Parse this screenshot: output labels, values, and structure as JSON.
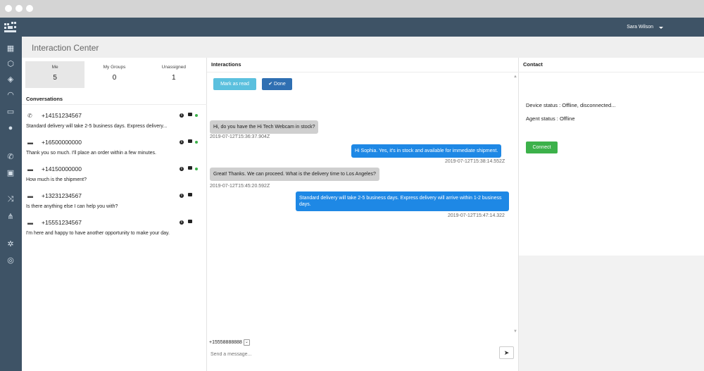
{
  "header": {
    "user_name": "Sara Wilson"
  },
  "nav": {
    "items": [
      {
        "icon": "dashboard-icon",
        "glyph": "▦"
      },
      {
        "icon": "cube-icon",
        "glyph": "⬡"
      },
      {
        "icon": "tag-icon",
        "glyph": "◈"
      },
      {
        "icon": "headset-icon",
        "glyph": "◠"
      },
      {
        "icon": "chat-icon",
        "glyph": "▭"
      },
      {
        "icon": "users-icon",
        "glyph": "●"
      },
      {
        "icon": "phone-icon",
        "glyph": "✆"
      },
      {
        "icon": "comment-alert-icon",
        "glyph": "▣"
      },
      {
        "icon": "shuffle-icon",
        "glyph": "⤨"
      },
      {
        "icon": "sitemap-icon",
        "glyph": "⋔"
      },
      {
        "icon": "gear-icon",
        "glyph": "✲"
      },
      {
        "icon": "lifebuoy-icon",
        "glyph": "◎"
      }
    ]
  },
  "page": {
    "title": "Interaction Center"
  },
  "tabs": [
    {
      "label": "Me",
      "count": "5"
    },
    {
      "label": "My Groups",
      "count": "0"
    },
    {
      "label": "Unassigned",
      "count": "1"
    }
  ],
  "conversations": {
    "heading": "Conversations",
    "items": [
      {
        "channel": "whatsapp-icon",
        "number": "+14151234567",
        "preview": "Standard delivery will take 2-5 business days. Express delivery...",
        "online": true
      },
      {
        "channel": "sms-icon",
        "number": "+16500000000",
        "preview": "Thank you so much. I'll place an order within a few minutes.",
        "online": true
      },
      {
        "channel": "sms-icon",
        "number": "+14150000000",
        "preview": "How much is the shipment?",
        "online": true
      },
      {
        "channel": "sms-icon",
        "number": "+13231234567",
        "preview": "Is there anything else I can help you with?",
        "online": false
      },
      {
        "channel": "sms-icon",
        "number": "+15551234567",
        "preview": "I'm here and happy to have another opportunity to make your day.",
        "online": false
      }
    ]
  },
  "interactions": {
    "heading": "Interactions",
    "mark_read_label": "Mark as read",
    "done_label": "Done",
    "messages": [
      {
        "dir": "in",
        "text": "Hi, do you have the Hi Tech Webcam in stock?",
        "time": "2019-07-12T15:36:37.904Z"
      },
      {
        "dir": "out",
        "text": "Hi Sophia. Yes, it's in stock and available for immediate shipment.",
        "time": "2019-07-12T15:38:14.552Z"
      },
      {
        "dir": "in",
        "text": "Great! Thanks. We can proceed. What is the delivery time to Los Angeles?",
        "time": "2019-07-12T15:45:20.592Z"
      },
      {
        "dir": "out",
        "text": "Standard delivery will take 2-5 business days. Express delivery will arrive within 1-2 business days.",
        "time": "2019-07-12T15:47:14.322"
      }
    ],
    "sender_number": "+15558888888",
    "message_placeholder": "Send a message..."
  },
  "contact": {
    "heading": "Contact",
    "device_status": "Device status : Offline, disconnected...",
    "agent_status": "Agent status : Offline",
    "connect_label": "Connect"
  }
}
